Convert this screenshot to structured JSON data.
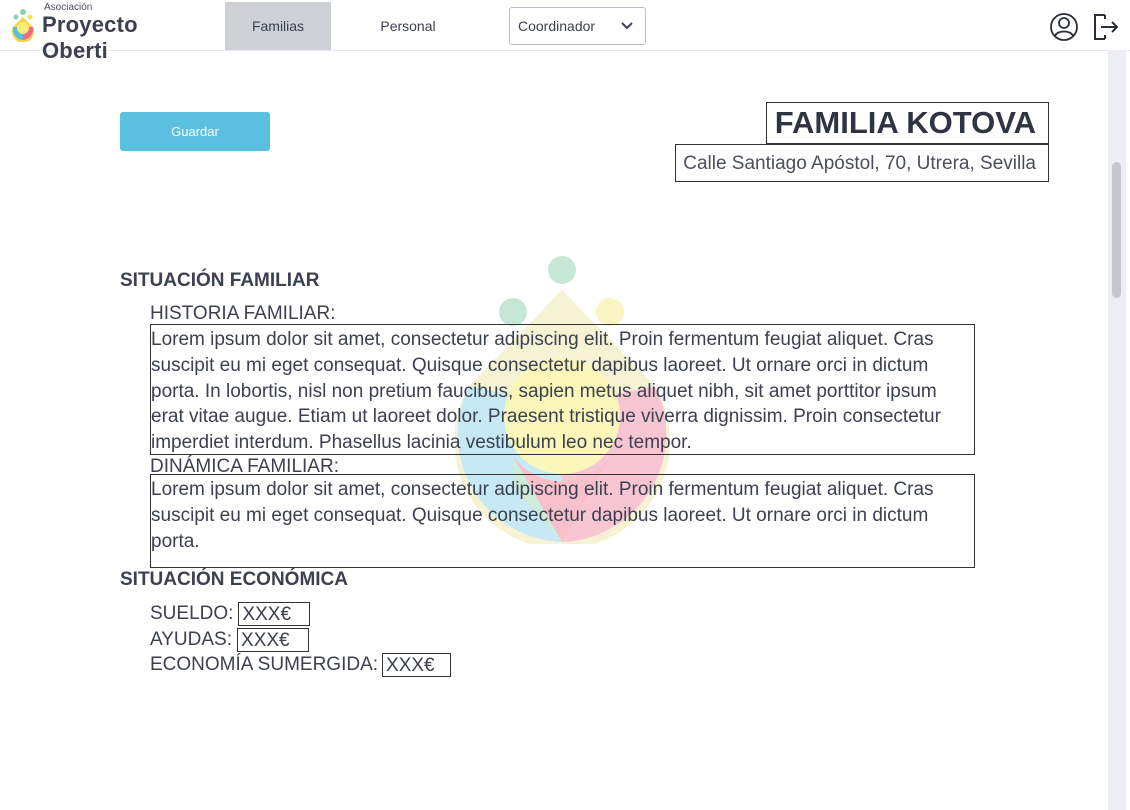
{
  "header": {
    "logo_small": "Asociación",
    "logo_big": "Proyecto Oberti",
    "tabs": [
      {
        "label": "Familias",
        "active": true
      },
      {
        "label": "Personal",
        "active": false
      }
    ],
    "role_select": {
      "value": "Coordinador"
    },
    "icons": {
      "user": "user-circle-icon",
      "logout": "logout-icon"
    }
  },
  "actions": {
    "save_label": "Guardar"
  },
  "family": {
    "name": "FAMILIA KOTOVA",
    "address": "Calle Santiago Apóstol, 70, Utrera, Sevilla"
  },
  "situacion_familiar": {
    "title": "SITUACIÓN FAMILIAR",
    "historia_label": "HISTORIA FAMILIAR:",
    "historia_text": "Lorem ipsum dolor sit amet, consectetur adipiscing elit. Proin fermentum feugiat aliquet. Cras suscipit eu mi eget consequat. Quisque consectetur dapibus laoreet. Ut ornare orci in dictum porta. In lobortis, nisl non pretium faucibus, sapien metus aliquet nibh, sit amet porttitor ipsum erat vitae augue. Etiam ut laoreet dolor. Praesent tristique viverra dignissim. Proin consectetur imperdiet interdum. Phasellus lacinia vestibulum leo nec tempor.",
    "dinamica_label": "DINÁMICA FAMILIAR:",
    "dinamica_text": "Lorem ipsum dolor sit amet, consectetur adipiscing elit. Proin fermentum feugiat aliquet. Cras suscipit eu mi eget consequat. Quisque consectetur dapibus laoreet. Ut ornare orci in dictum porta."
  },
  "situacion_economica": {
    "title": "SITUACIÓN ECONÓMICA",
    "sueldo_label": "SUELDO:",
    "sueldo_value": "XXX€",
    "ayudas_label": "AYUDAS:",
    "ayudas_value": "XXX€",
    "sumergida_label": "ECONOMÍA SUMERGIDA:",
    "sumergida_value": "XXX€"
  },
  "colors": {
    "accent_button": "#5bbfe0",
    "active_tab": "#cdd1d6",
    "text": "#3b4150"
  }
}
